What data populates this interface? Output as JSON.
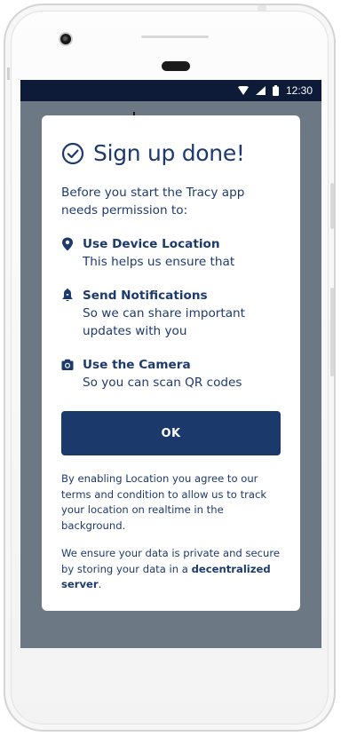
{
  "status_bar": {
    "time": "12:30",
    "icons": [
      "wifi-icon",
      "signal-icon",
      "battery-icon"
    ]
  },
  "dialog": {
    "title_icon": "check-circle-icon",
    "title": "Sign up done!",
    "intro": "Before you start the Tracy app needs permission to:",
    "permissions": [
      {
        "icon": "location-pin-icon",
        "title": "Use Device Location",
        "description": "This helps us ensure that"
      },
      {
        "icon": "bell-icon",
        "title": "Send Notifications",
        "description": "So we can share important updates with you"
      },
      {
        "icon": "camera-icon",
        "title": "Use the Camera",
        "description": "So you can scan QR codes"
      }
    ],
    "ok_label": "OK",
    "legal_location": "By enabling Location you agree to our terms and condition to allow us to track your location on realtime in the background.",
    "legal_privacy_prefix": "We ensure your data is private and secure by storing your data in a ",
    "legal_privacy_bold": "decentralized server",
    "legal_privacy_suffix": "."
  },
  "colors": {
    "primary": "#1b3a6b",
    "text": "#1d3a6e",
    "overlay": "#6c7884",
    "status_bar": "#0d1a38"
  }
}
